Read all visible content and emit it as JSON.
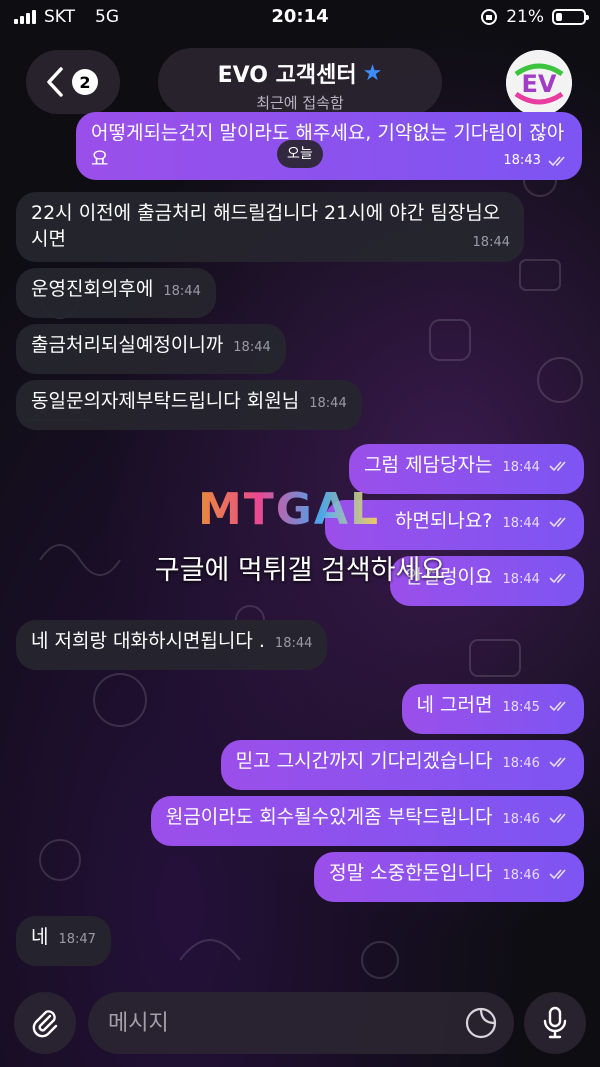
{
  "status_bar": {
    "carrier": "SKT",
    "network": "5G",
    "time": "20:14",
    "battery": "21%"
  },
  "header": {
    "back_count": "2",
    "title": "EVO 고객센터",
    "subtitle": "최근에 접속함",
    "avatar_text": "EV"
  },
  "date_label": "오늘",
  "messages": [
    {
      "dir": "out",
      "text": "어떻게되는건지 말이라도 해주세요, 기약없는 기다림이 잖아요",
      "time": "18:43"
    },
    {
      "dir": "in",
      "text": "22시 이전에 출금처리 해드릴겁니다 21시에 야간 팀장님오시면",
      "time": "18:44"
    },
    {
      "dir": "in",
      "text": "운영진회의후에",
      "time": "18:44"
    },
    {
      "dir": "in",
      "text": "출금처리되실예정이니까",
      "time": "18:44"
    },
    {
      "dir": "in",
      "text": "동일문의자제부탁드립니다 회원님",
      "time": "18:44"
    },
    {
      "dir": "out",
      "text": "그럼 제담당자는",
      "time": "18:44"
    },
    {
      "dir": "out",
      "text": "하면되나요?",
      "time": "18:44"
    },
    {
      "dir": "out",
      "text": "안걸렁이요",
      "time": "18:44"
    },
    {
      "dir": "in",
      "text": "네 저희랑 대화하시면됩니다 .",
      "time": "18:44"
    },
    {
      "dir": "out",
      "text": "네 그러면",
      "time": "18:45"
    },
    {
      "dir": "out",
      "text": "믿고 그시간까지 기다리겠습니다",
      "time": "18:46"
    },
    {
      "dir": "out",
      "text": "원금이라도 회수될수있게좀 부탁드립니다",
      "time": "18:46"
    },
    {
      "dir": "out",
      "text": "정말 소중한돈입니다",
      "time": "18:46"
    },
    {
      "dir": "in",
      "text": "네",
      "time": "18:47"
    }
  ],
  "watermark": {
    "logo": "MTGAL",
    "text": "구글에 먹튀갤 검색하세요"
  },
  "input": {
    "placeholder": "메시지"
  },
  "colors": {
    "outgoing_bubble": "#8a52ee",
    "incoming_bubble": "#26262e",
    "verified_star": "#3d8dff"
  }
}
